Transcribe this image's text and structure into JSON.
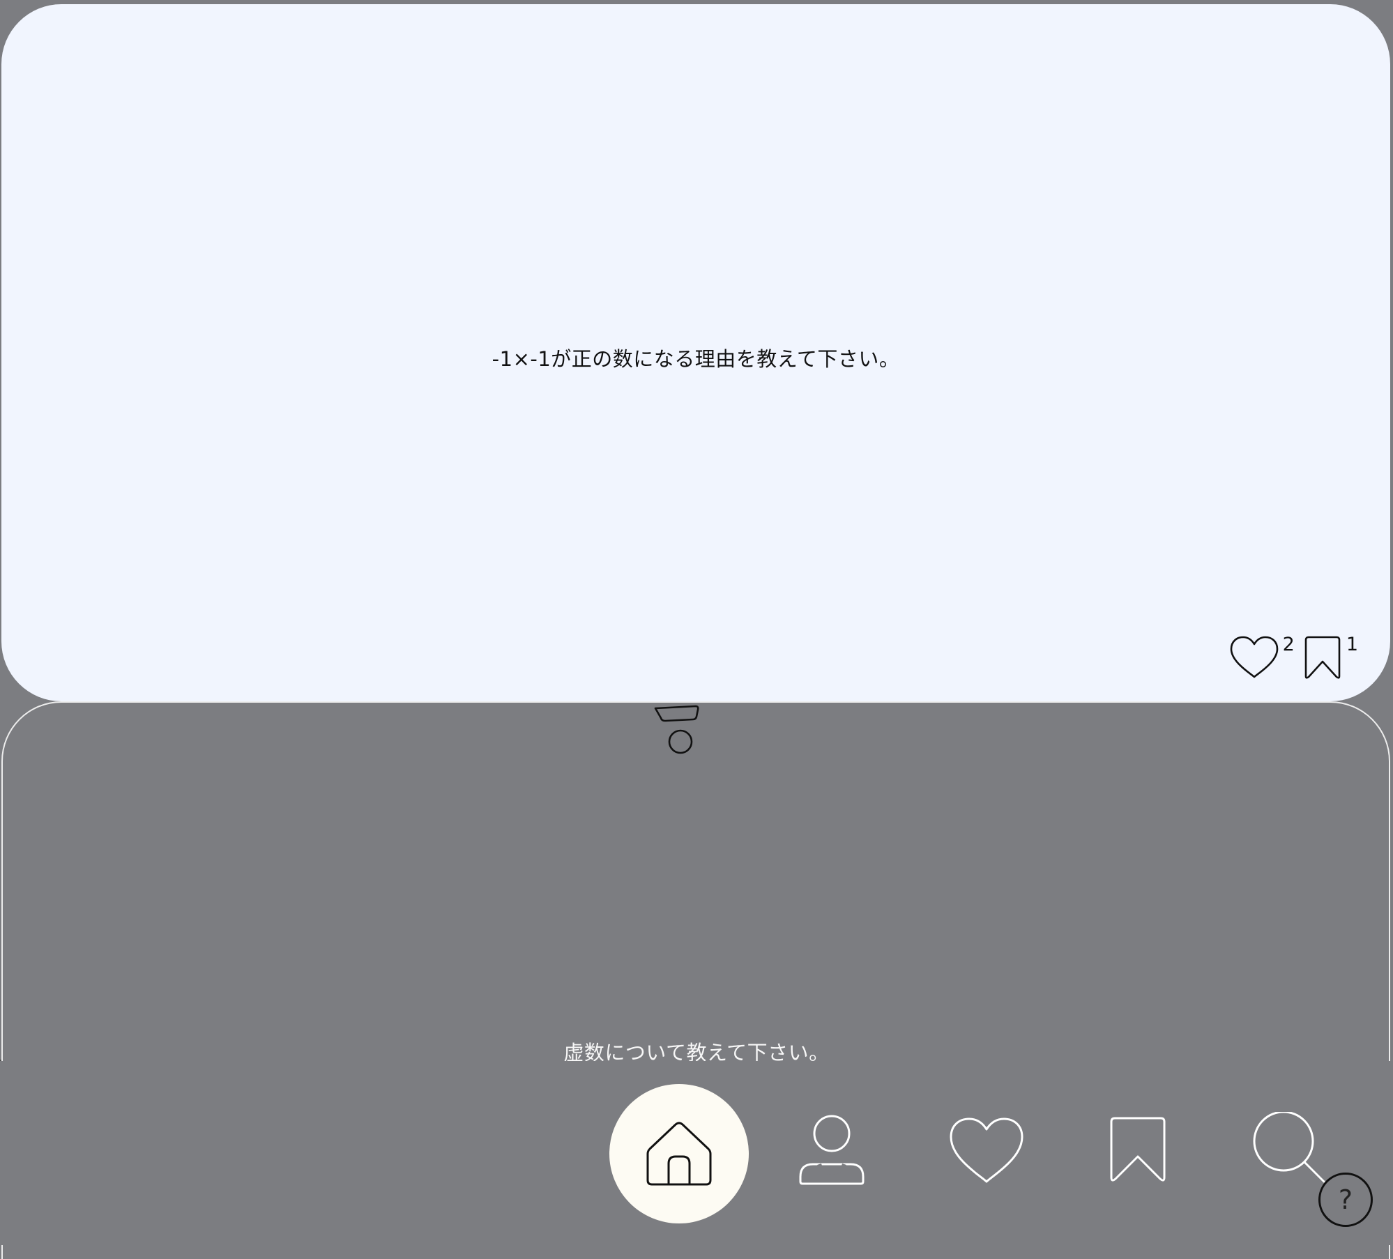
{
  "posts": [
    {
      "question": "-1×-1が正の数になる理由を教えて下さい。",
      "likes": "2",
      "bookmarks": "1"
    },
    {
      "question": "虚数について教えて下さい。"
    }
  ],
  "nav": {
    "items": [
      "home-icon",
      "profile-icon",
      "heart-icon",
      "bookmark-icon",
      "search-icon"
    ],
    "active": "home-icon"
  },
  "help": {
    "label": "?"
  },
  "colors": {
    "background": "#7c7d81",
    "card": "#f1f5fe",
    "active_nav": "#fdfbf3"
  }
}
